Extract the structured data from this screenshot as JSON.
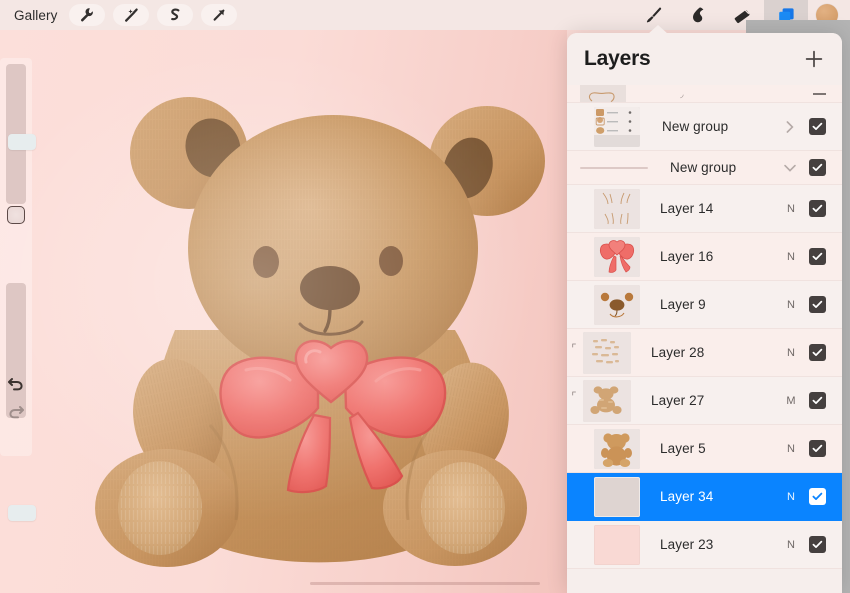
{
  "app": {
    "name": "Procreate",
    "accent_blue": "#0a84ff",
    "canvas_bg": "#fbdcd7",
    "panel_bg": "#f6eeec"
  },
  "topbar": {
    "gallery_label": "Gallery",
    "left_tools": [
      {
        "name": "wrench-icon",
        "label": "Actions"
      },
      {
        "name": "magic-wand-icon",
        "label": "Adjustments"
      },
      {
        "name": "selection-s-icon",
        "label": "Selection"
      },
      {
        "name": "transform-arrow-icon",
        "label": "Transform"
      }
    ],
    "right_tools": [
      {
        "name": "paintbrush-icon",
        "label": "Paint",
        "active": false
      },
      {
        "name": "smudge-icon",
        "label": "Smudge",
        "active": false
      },
      {
        "name": "eraser-icon",
        "label": "Erase",
        "active": false
      },
      {
        "name": "layers-icon",
        "label": "Layers",
        "active": true
      }
    ],
    "color_swatch": {
      "name": "color-swatch",
      "label": "Color",
      "hex": "#d59f6c"
    }
  },
  "sidebar": {
    "brush_size": {
      "label": "Brush size",
      "value_percent": 50
    },
    "modify_button": {
      "label": "Modify"
    },
    "brush_opacity": {
      "label": "Brush opacity",
      "value_percent": 100
    },
    "undo": {
      "label": "Undo",
      "enabled": true
    },
    "redo": {
      "label": "Redo",
      "enabled": false
    }
  },
  "layers_panel": {
    "title": "Layers",
    "add_button_label": "+",
    "layers": [
      {
        "id": "partial",
        "name": "",
        "blend": "",
        "visible": true,
        "kind": "partial",
        "thumb": "outline-shape"
      },
      {
        "id": "group-1",
        "name": "New group",
        "blend": "",
        "visible": true,
        "kind": "group",
        "collapsed": true,
        "chevron": "chevron-right-icon",
        "thumb": "mini-layer-list"
      },
      {
        "id": "group-2",
        "name": "New group",
        "blend": "",
        "visible": true,
        "kind": "group",
        "collapsed": false,
        "chevron": "chevron-down-icon",
        "thumb": "group-line"
      },
      {
        "id": "layer-14",
        "name": "Layer 14",
        "blend": "N",
        "visible": true,
        "kind": "layer",
        "indented": false,
        "thumb": "sketch-lines"
      },
      {
        "id": "layer-16",
        "name": "Layer 16",
        "blend": "N",
        "visible": true,
        "kind": "layer",
        "indented": false,
        "thumb": "pink-bow"
      },
      {
        "id": "layer-9",
        "name": "Layer 9",
        "blend": "N",
        "visible": true,
        "kind": "layer",
        "indented": false,
        "thumb": "bear-face"
      },
      {
        "id": "layer-28",
        "name": "Layer 28",
        "blend": "N",
        "visible": true,
        "kind": "layer",
        "indented": true,
        "thumb": "fur-texture-light"
      },
      {
        "id": "layer-27",
        "name": "Layer 27",
        "blend": "M",
        "visible": true,
        "kind": "layer",
        "indented": true,
        "thumb": "bear-body-texture"
      },
      {
        "id": "layer-5",
        "name": "Layer 5",
        "blend": "N",
        "visible": true,
        "kind": "layer",
        "indented": false,
        "thumb": "bear-silhouette"
      },
      {
        "id": "layer-34",
        "name": "Layer 34",
        "blend": "N",
        "visible": true,
        "kind": "layer",
        "indented": false,
        "selected": true,
        "thumb": "empty-gray"
      },
      {
        "id": "layer-23",
        "name": "Layer 23",
        "blend": "N",
        "visible": true,
        "kind": "layer",
        "indented": false,
        "thumb": "pink-fill"
      }
    ]
  },
  "artwork": {
    "subject": "teddy bear with heart bow",
    "colors": {
      "fur_base": "#c08e5d",
      "fur_light": "#d2a477",
      "fur_dark": "#a8774a",
      "inner_ear": "#6a4a2c",
      "eye": "#7a5230",
      "nose": "#6b4526",
      "bow": "#ef6d68",
      "bow_dark": "#d9504c",
      "bow_light": "#f58a86",
      "background": "#fbdcd7"
    }
  }
}
